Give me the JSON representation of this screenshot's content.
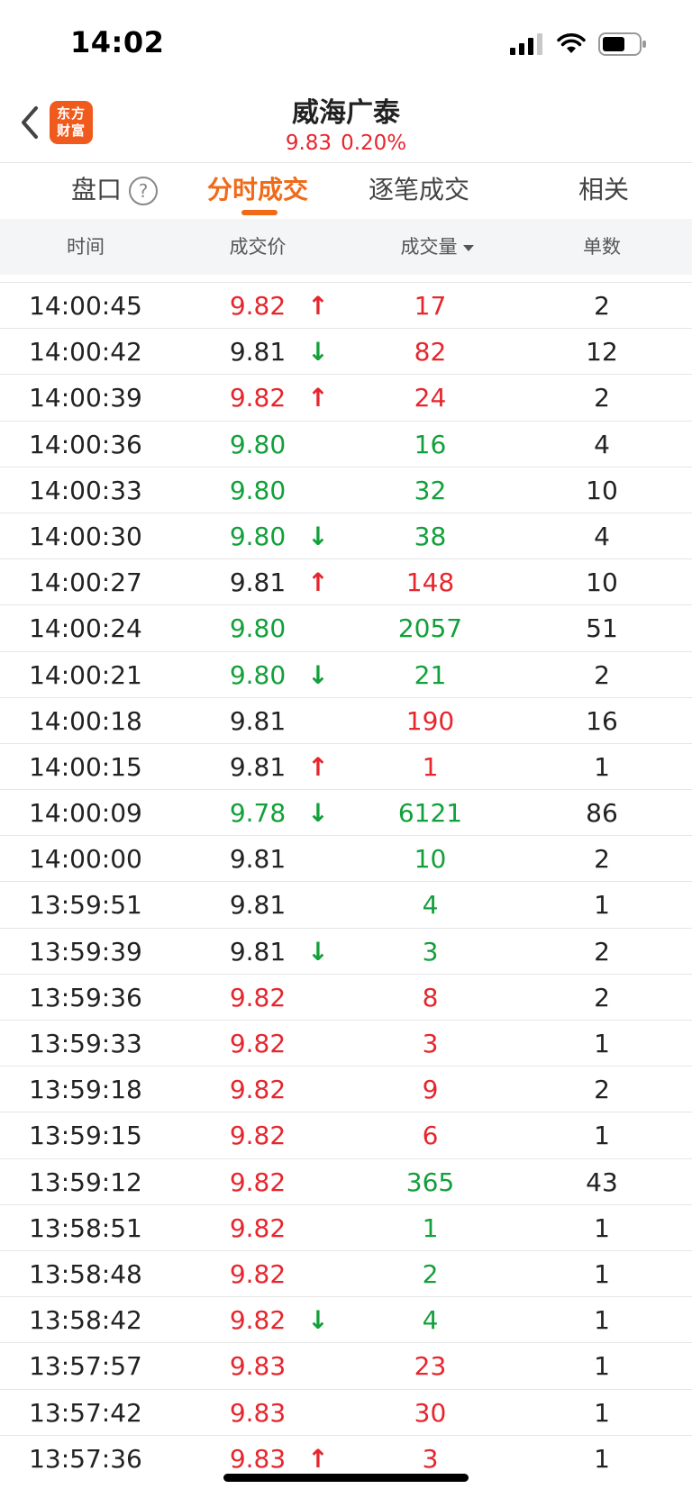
{
  "status_bar": {
    "time": "14:02"
  },
  "header": {
    "logo_line1": "东方",
    "logo_line2": "财富",
    "title": "威海广泰",
    "price": "9.83",
    "change": "0.20%"
  },
  "tabs": [
    {
      "label": "盘口",
      "help": "?"
    },
    {
      "label": "分时成交"
    },
    {
      "label": "逐笔成交"
    },
    {
      "label": "相关"
    }
  ],
  "columns": {
    "time": "时间",
    "price": "成交价",
    "volume": "成交量",
    "count": "单数"
  },
  "colors": {
    "up": "#e6262d",
    "down": "#12a03a",
    "neutral": "#222222",
    "accent": "#f06a18"
  },
  "trades": [
    {
      "time": "14:00:45",
      "price": "9.82",
      "price_color": "red",
      "arrow": "↑",
      "volume": "17",
      "volume_color": "red",
      "count": "2"
    },
    {
      "time": "14:00:42",
      "price": "9.81",
      "price_color": "neutral",
      "arrow": "↓",
      "volume": "82",
      "volume_color": "red",
      "count": "12"
    },
    {
      "time": "14:00:39",
      "price": "9.82",
      "price_color": "red",
      "arrow": "↑",
      "volume": "24",
      "volume_color": "red",
      "count": "2"
    },
    {
      "time": "14:00:36",
      "price": "9.80",
      "price_color": "green",
      "arrow": "",
      "volume": "16",
      "volume_color": "green",
      "count": "4"
    },
    {
      "time": "14:00:33",
      "price": "9.80",
      "price_color": "green",
      "arrow": "",
      "volume": "32",
      "volume_color": "green",
      "count": "10"
    },
    {
      "time": "14:00:30",
      "price": "9.80",
      "price_color": "green",
      "arrow": "↓",
      "volume": "38",
      "volume_color": "green",
      "count": "4"
    },
    {
      "time": "14:00:27",
      "price": "9.81",
      "price_color": "neutral",
      "arrow": "↑",
      "volume": "148",
      "volume_color": "red",
      "count": "10"
    },
    {
      "time": "14:00:24",
      "price": "9.80",
      "price_color": "green",
      "arrow": "",
      "volume": "2057",
      "volume_color": "green",
      "count": "51"
    },
    {
      "time": "14:00:21",
      "price": "9.80",
      "price_color": "green",
      "arrow": "↓",
      "volume": "21",
      "volume_color": "green",
      "count": "2"
    },
    {
      "time": "14:00:18",
      "price": "9.81",
      "price_color": "neutral",
      "arrow": "",
      "volume": "190",
      "volume_color": "red",
      "count": "16"
    },
    {
      "time": "14:00:15",
      "price": "9.81",
      "price_color": "neutral",
      "arrow": "↑",
      "volume": "1",
      "volume_color": "red",
      "count": "1"
    },
    {
      "time": "14:00:09",
      "price": "9.78",
      "price_color": "green",
      "arrow": "↓",
      "volume": "6121",
      "volume_color": "green",
      "count": "86"
    },
    {
      "time": "14:00:00",
      "price": "9.81",
      "price_color": "neutral",
      "arrow": "",
      "volume": "10",
      "volume_color": "green",
      "count": "2"
    },
    {
      "time": "13:59:51",
      "price": "9.81",
      "price_color": "neutral",
      "arrow": "",
      "volume": "4",
      "volume_color": "green",
      "count": "1"
    },
    {
      "time": "13:59:39",
      "price": "9.81",
      "price_color": "neutral",
      "arrow": "↓",
      "volume": "3",
      "volume_color": "green",
      "count": "2"
    },
    {
      "time": "13:59:36",
      "price": "9.82",
      "price_color": "red",
      "arrow": "",
      "volume": "8",
      "volume_color": "red",
      "count": "2"
    },
    {
      "time": "13:59:33",
      "price": "9.82",
      "price_color": "red",
      "arrow": "",
      "volume": "3",
      "volume_color": "red",
      "count": "1"
    },
    {
      "time": "13:59:18",
      "price": "9.82",
      "price_color": "red",
      "arrow": "",
      "volume": "9",
      "volume_color": "red",
      "count": "2"
    },
    {
      "time": "13:59:15",
      "price": "9.82",
      "price_color": "red",
      "arrow": "",
      "volume": "6",
      "volume_color": "red",
      "count": "1"
    },
    {
      "time": "13:59:12",
      "price": "9.82",
      "price_color": "red",
      "arrow": "",
      "volume": "365",
      "volume_color": "green",
      "count": "43"
    },
    {
      "time": "13:58:51",
      "price": "9.82",
      "price_color": "red",
      "arrow": "",
      "volume": "1",
      "volume_color": "green",
      "count": "1"
    },
    {
      "time": "13:58:48",
      "price": "9.82",
      "price_color": "red",
      "arrow": "",
      "volume": "2",
      "volume_color": "green",
      "count": "1"
    },
    {
      "time": "13:58:42",
      "price": "9.82",
      "price_color": "red",
      "arrow": "↓",
      "volume": "4",
      "volume_color": "green",
      "count": "1"
    },
    {
      "time": "13:57:57",
      "price": "9.83",
      "price_color": "red",
      "arrow": "",
      "volume": "23",
      "volume_color": "red",
      "count": "1"
    },
    {
      "time": "13:57:42",
      "price": "9.83",
      "price_color": "red",
      "arrow": "",
      "volume": "30",
      "volume_color": "red",
      "count": "1"
    },
    {
      "time": "13:57:36",
      "price": "9.83",
      "price_color": "red",
      "arrow": "↑",
      "volume": "3",
      "volume_color": "red",
      "count": "1"
    }
  ]
}
